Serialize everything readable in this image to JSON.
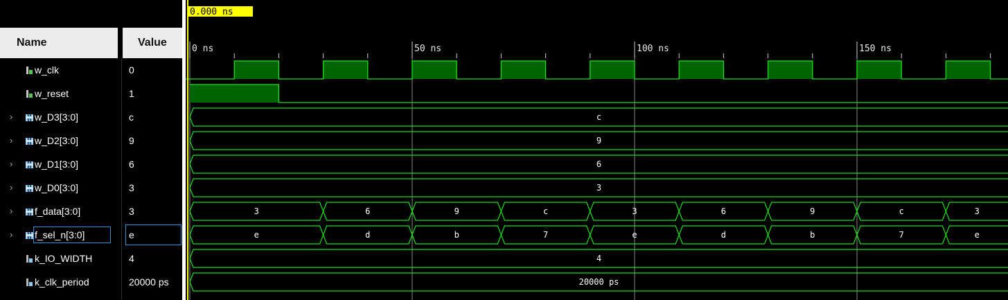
{
  "cursor": {
    "label": "0.000 ns",
    "time_ns": 0
  },
  "columns": {
    "name": "Name",
    "value": "Value"
  },
  "time_axis": {
    "labels": [
      {
        "t": 0,
        "text": "0 ns"
      },
      {
        "t": 50,
        "text": "50 ns"
      },
      {
        "t": 100,
        "text": "100 ns"
      },
      {
        "t": 150,
        "text": "150 ns"
      }
    ],
    "visible_range_ns": [
      0,
      184
    ]
  },
  "colors": {
    "wave": "#18e018",
    "fill": "#006400",
    "grid": "#8a8a8a",
    "cursor": "#ffff00",
    "bus_text": "#ffffff",
    "selection": "#2e8fd6"
  },
  "signals": [
    {
      "name": "w_clk",
      "value": "0",
      "type": "bit",
      "icon": "bit-signal-icon",
      "expandable": false,
      "wave": {
        "kind": "clock",
        "period": 20,
        "high_start": 10
      }
    },
    {
      "name": "w_reset",
      "value": "1",
      "type": "bit",
      "icon": "bit-signal-icon",
      "expandable": false,
      "wave": {
        "kind": "bit",
        "points": [
          [
            0,
            1
          ],
          [
            20,
            0
          ]
        ]
      }
    },
    {
      "name": "w_D3[3:0]",
      "value": "c",
      "type": "bus",
      "icon": "bus-signal-icon",
      "expandable": true,
      "wave": {
        "kind": "bus",
        "segments": [
          {
            "start": 0,
            "end": 200,
            "label": "c"
          }
        ]
      }
    },
    {
      "name": "w_D2[3:0]",
      "value": "9",
      "type": "bus",
      "icon": "bus-signal-icon",
      "expandable": true,
      "wave": {
        "kind": "bus",
        "segments": [
          {
            "start": 0,
            "end": 200,
            "label": "9"
          }
        ]
      }
    },
    {
      "name": "w_D1[3:0]",
      "value": "6",
      "type": "bus",
      "icon": "bus-signal-icon",
      "expandable": true,
      "wave": {
        "kind": "bus",
        "segments": [
          {
            "start": 0,
            "end": 200,
            "label": "6"
          }
        ]
      }
    },
    {
      "name": "w_D0[3:0]",
      "value": "3",
      "type": "bus",
      "icon": "bus-signal-icon",
      "expandable": true,
      "wave": {
        "kind": "bus",
        "segments": [
          {
            "start": 0,
            "end": 200,
            "label": "3"
          }
        ]
      }
    },
    {
      "name": "f_data[3:0]",
      "value": "3",
      "type": "bus",
      "icon": "bus-signal-icon",
      "expandable": true,
      "wave": {
        "kind": "bus",
        "segments": [
          {
            "start": 0,
            "end": 30,
            "label": "3"
          },
          {
            "start": 30,
            "end": 50,
            "label": "6"
          },
          {
            "start": 50,
            "end": 70,
            "label": "9"
          },
          {
            "start": 70,
            "end": 90,
            "label": "c"
          },
          {
            "start": 90,
            "end": 110,
            "label": "3"
          },
          {
            "start": 110,
            "end": 130,
            "label": "6"
          },
          {
            "start": 130,
            "end": 150,
            "label": "9"
          },
          {
            "start": 150,
            "end": 170,
            "label": "c"
          },
          {
            "start": 170,
            "end": 200,
            "label": "3"
          }
        ]
      }
    },
    {
      "name": "f_sel_n[3:0]",
      "value": "e",
      "type": "bus",
      "icon": "bus-signal-icon",
      "expandable": true,
      "selected": true,
      "wave": {
        "kind": "bus",
        "segments": [
          {
            "start": 0,
            "end": 30,
            "label": "e"
          },
          {
            "start": 30,
            "end": 50,
            "label": "d"
          },
          {
            "start": 50,
            "end": 70,
            "label": "b"
          },
          {
            "start": 70,
            "end": 90,
            "label": "7"
          },
          {
            "start": 90,
            "end": 110,
            "label": "e"
          },
          {
            "start": 110,
            "end": 130,
            "label": "d"
          },
          {
            "start": 130,
            "end": 150,
            "label": "b"
          },
          {
            "start": 150,
            "end": 170,
            "label": "7"
          },
          {
            "start": 170,
            "end": 200,
            "label": "e"
          }
        ]
      }
    },
    {
      "name": "k_IO_WIDTH",
      "value": "4",
      "type": "param",
      "icon": "param-signal-icon",
      "expandable": false,
      "wave": {
        "kind": "bus",
        "segments": [
          {
            "start": 0,
            "end": 200,
            "label": "4"
          }
        ]
      }
    },
    {
      "name": "k_clk_period",
      "value": "20000 ps",
      "type": "param",
      "icon": "param-signal-icon",
      "expandable": false,
      "wave": {
        "kind": "bus",
        "segments": [
          {
            "start": 0,
            "end": 200,
            "label": "20000 ps"
          }
        ]
      }
    }
  ]
}
